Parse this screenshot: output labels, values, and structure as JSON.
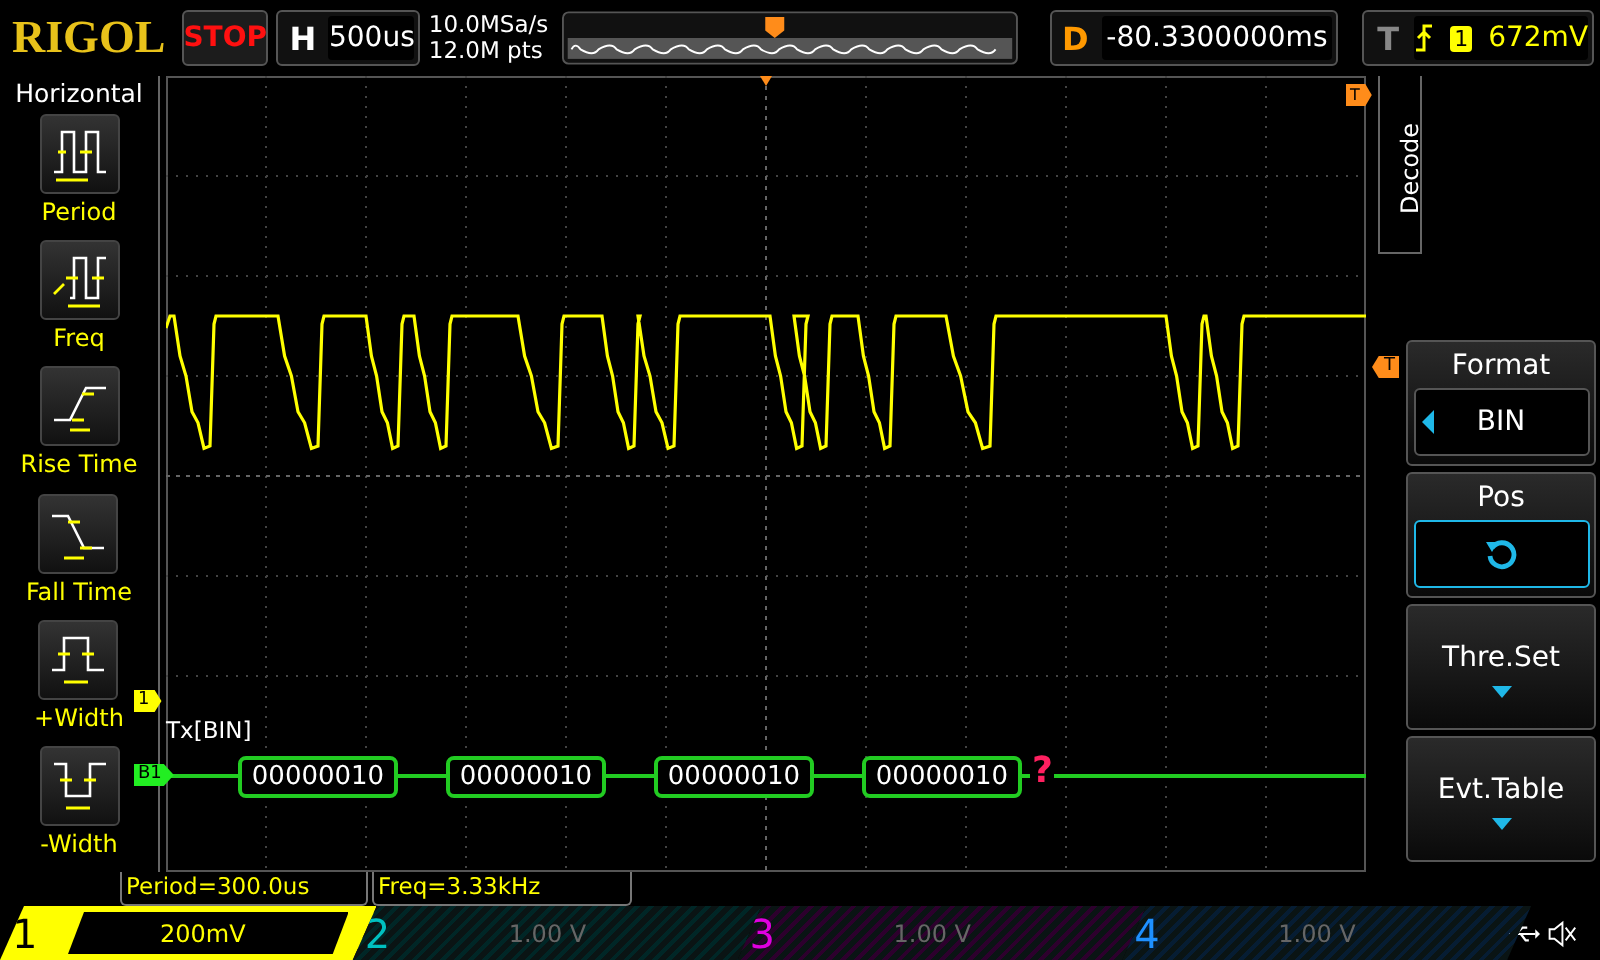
{
  "header": {
    "logo": "RIGOL",
    "run_state": "STOP",
    "timebase": {
      "label": "H",
      "value": "500us"
    },
    "sample_rate": "10.0MSa/s",
    "memory_depth": "12.0M pts",
    "delay": {
      "label": "D",
      "value": "-80.3300000ms"
    },
    "trigger": {
      "label": "T",
      "channel": "1",
      "level": "672mV"
    }
  },
  "left_menu": {
    "title": "Horizontal",
    "items": [
      {
        "label": "Period",
        "kind": "period"
      },
      {
        "label": "Freq",
        "kind": "freq"
      },
      {
        "label": "Rise Time",
        "kind": "rise"
      },
      {
        "label": "Fall Time",
        "kind": "fall"
      },
      {
        "label": "+Width",
        "kind": "pwidth"
      },
      {
        "label": "-Width",
        "kind": "nwidth"
      }
    ]
  },
  "plot": {
    "channel_marker": "1",
    "bus_marker": "B1",
    "bus_label": "Tx[BIN]",
    "packets": [
      "00000010",
      "00000010",
      "00000010",
      "00000010"
    ],
    "error_mark": "?",
    "trigger_marker_top": "T",
    "trigger_marker_side": "T"
  },
  "right_menu": {
    "tab": "Decode",
    "items": [
      {
        "title": "Format",
        "kind": "value",
        "value": "BIN"
      },
      {
        "title": "Pos",
        "kind": "knob"
      },
      {
        "title": "Thre.Set",
        "kind": "submenu"
      },
      {
        "title": "Evt.Table",
        "kind": "submenu"
      }
    ]
  },
  "measurements": [
    "Period=300.0us",
    "Freq=3.33kHz"
  ],
  "channels": [
    {
      "number": "1",
      "scale": "200mV",
      "active": true,
      "color": "#ffff00"
    },
    {
      "number": "2",
      "scale": "1.00 V",
      "active": false,
      "color": "#00c0c0"
    },
    {
      "number": "3",
      "scale": "1.00 V",
      "active": false,
      "color": "#e000e0"
    },
    {
      "number": "4",
      "scale": "1.00 V",
      "active": false,
      "color": "#1e90ff"
    }
  ]
}
